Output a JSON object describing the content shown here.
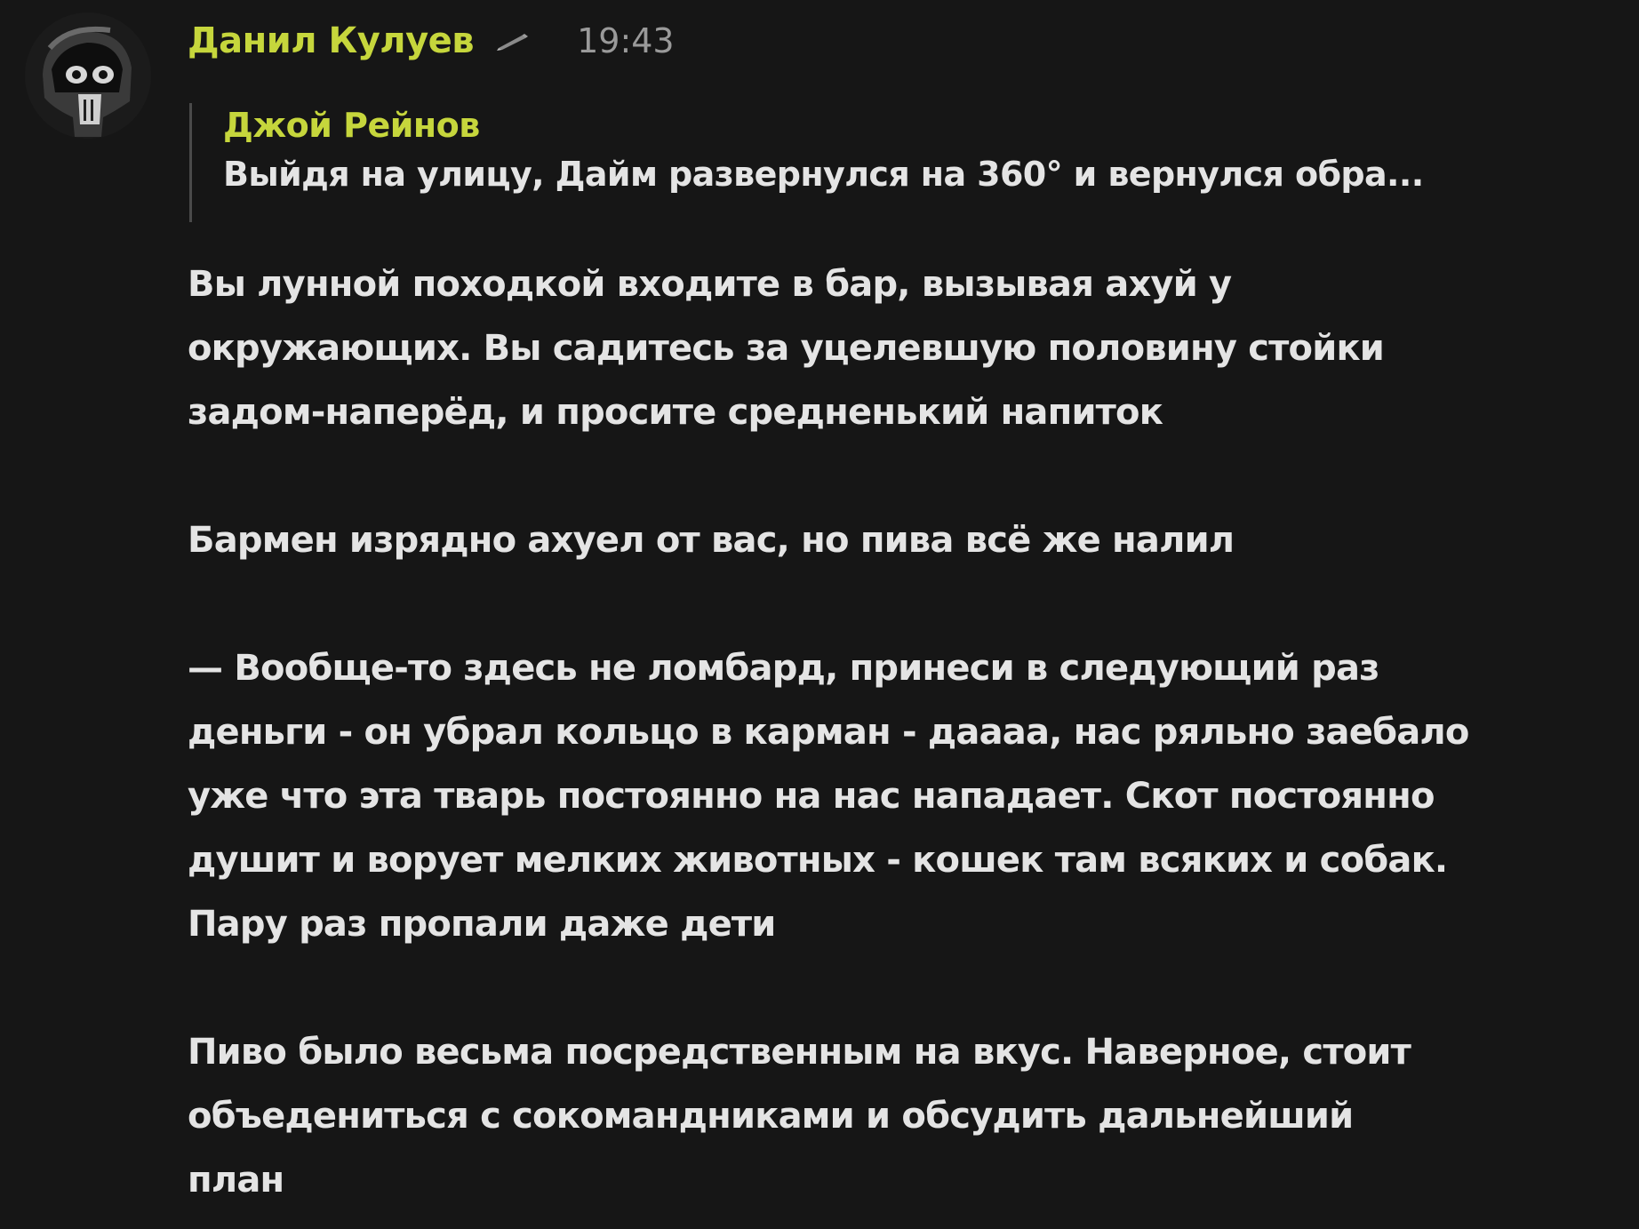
{
  "message": {
    "author": "Данил Кулуев",
    "time": "19:43",
    "edited_icon": "pen-icon",
    "avatar_icon": "hooded-skull-avatar",
    "reply": {
      "author": "Джой Рейнов",
      "text": "Выйдя на улицу, Дайм развернулся на 360° и вернулся обра..."
    },
    "lines": [
      "Вы лунной походкой входите в бар, вызывая ахуй у",
      "окружающих. Вы садитесь за уцелевшую половину стойки",
      "задом-наперёд, и просите средненький напиток",
      "",
      "Бармен изрядно ахуел от вас, но пива всё же налил",
      "",
      "— Вообще-то здесь не ломбард, принеси в следующий раз",
      "деньги - он убрал кольцо в карман - даааа, нас ряльно заебало",
      "уже что эта тварь постоянно на нас нападает. Скот постоянно",
      "душит и ворует мелких животных - кошек там всяких и собак.",
      "Пару раз пропали даже дети",
      "",
      "Пиво было весьма посредственным на вкус. Наверное, стоит",
      "объедениться с сокомандниками и обсудить дальнейший",
      "план"
    ]
  },
  "colors": {
    "background": "#161616",
    "author": "#c6d63c",
    "text": "#e4e4e4",
    "time": "#9a9a9a",
    "reply_bar": "#4a4a4a"
  }
}
